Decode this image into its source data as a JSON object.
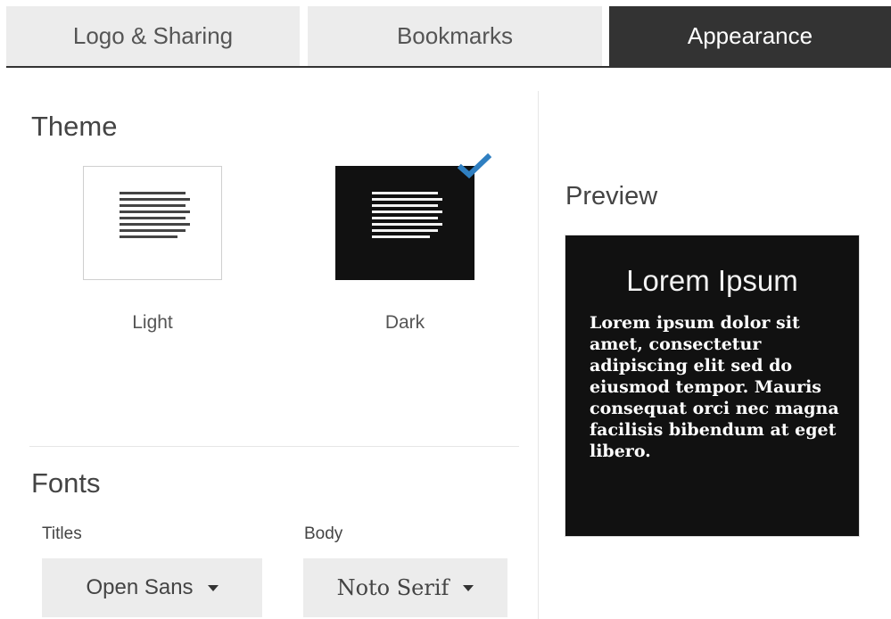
{
  "tabs": [
    {
      "label": "Logo & Sharing"
    },
    {
      "label": "Bookmarks"
    },
    {
      "label": "Appearance"
    }
  ],
  "theme": {
    "title": "Theme",
    "options": [
      {
        "label": "Light"
      },
      {
        "label": "Dark"
      }
    ],
    "selected": "Dark"
  },
  "fonts": {
    "title": "Fonts",
    "titles_label": "Titles",
    "body_label": "Body",
    "titles_value": "Open Sans",
    "body_value": "Noto Serif"
  },
  "preview": {
    "title": "Preview",
    "heading": "Lorem Ipsum",
    "body": "Lorem ipsum dolor sit amet, consectetur adipiscing elit sed do eiusmod tempor. Mauris consequat orci nec magna facilisis bibendum at eget libero."
  },
  "colors": {
    "active_tab": "#333333",
    "inactive_tab": "#ececec",
    "checkmark": "#2f7fc1",
    "dark_theme": "#111111"
  }
}
